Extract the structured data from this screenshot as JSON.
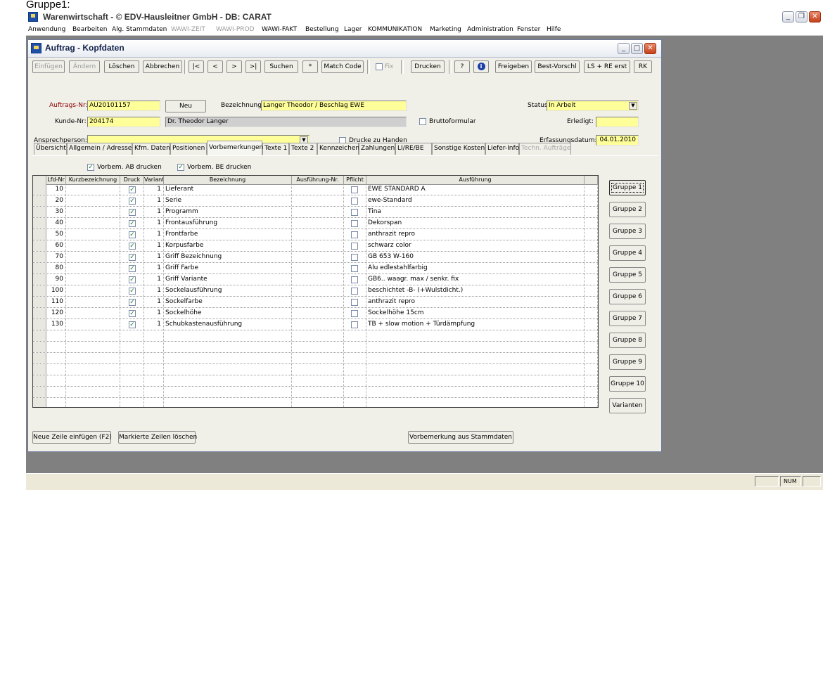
{
  "caption": "Gruppe1:",
  "app": {
    "title": "Warenwirtschaft - © EDV-Hausleitner GmbH - DB: CARAT",
    "menu": [
      "Anwendung",
      "Bearbeiten",
      "Alg. Stammdaten",
      "WAWI-ZEIT",
      "WAWI-PROD",
      "WAWI-FAKT",
      "Bestellung",
      "Lager",
      "KOMMUNIKATION",
      "Marketing",
      "Administration",
      "Fenster",
      "Hilfe"
    ],
    "status_num": "NUM"
  },
  "window": {
    "title": "Auftrag - Kopfdaten",
    "toolbar": {
      "einfuegen": "Einfügen",
      "aendern": "Ändern",
      "loeschen": "Löschen",
      "abbrechen": "Abbrechen",
      "first": "|<",
      "prev": "<",
      "next": ">",
      "last": ">|",
      "suchen": "Suchen",
      "star": "*",
      "match_code": "Match Code",
      "fix": "Fix",
      "drucken": "Drucken",
      "help": "?",
      "info": "i",
      "freigeben": "Freigeben",
      "best_vorschl": "Best-Vorschl",
      "ls_re_erst": "LS + RE erst",
      "rk": "RK"
    },
    "form": {
      "auftrags_nr_label": "Auftrags-Nr:",
      "auftrags_nr": "AU20101157",
      "neu": "Neu",
      "bezeichnung_label": "Bezeichnung:",
      "bezeichnung": "Langer Theodor / Beschlag EWE",
      "status_label": "Status:",
      "status": "In Arbeit",
      "kunde_nr_label": "Kunde-Nr:",
      "kunde_nr": "204174",
      "kunde_name": "Dr. Theodor Langer",
      "bruttoformular": "Bruttoformular",
      "erledigt_label": "Erledigt:",
      "erledigt": "",
      "ansprechperson_label": "Ansprechperson:",
      "ansprechperson": "",
      "drucke_zu_handen": "Drucke zu Handen",
      "erfassungsdatum_label": "Erfassungsdatum:",
      "erfassungsdatum": "04.01.2010"
    },
    "tabs": [
      "Übersicht",
      "Allgemein / Adressen",
      "Kfm. Daten",
      "Positionen",
      "Vorbemerkungen",
      "Texte 1",
      "Texte 2",
      "Kennzeichen",
      "Zahlungen",
      "LI/RE/BE",
      "Sonstige Kosten",
      "Liefer-Info",
      "Techn. Aufträge"
    ],
    "print_ab": "Vorbem. AB drucken",
    "print_be": "Vorbem. BE drucken",
    "grid": {
      "columns": [
        "Lfd-Nr",
        "Kurzbezeichnung",
        "Druck",
        "Variante",
        "Bezeichnung",
        "Ausführung-Nr.",
        "Pflicht",
        "Ausführung"
      ],
      "rows": [
        {
          "nr": "10",
          "kurz": "",
          "var": "1",
          "bez": "Lieferant",
          "ausf_nr": "",
          "ausf": "EWE STANDARD A"
        },
        {
          "nr": "20",
          "kurz": "",
          "var": "1",
          "bez": "Serie",
          "ausf_nr": "",
          "ausf": "ewe-Standard"
        },
        {
          "nr": "30",
          "kurz": "",
          "var": "1",
          "bez": "Programm",
          "ausf_nr": "",
          "ausf": "Tina"
        },
        {
          "nr": "40",
          "kurz": "",
          "var": "1",
          "bez": "Frontausführung",
          "ausf_nr": "",
          "ausf": "Dekorspan"
        },
        {
          "nr": "50",
          "kurz": "",
          "var": "1",
          "bez": "Frontfarbe",
          "ausf_nr": "",
          "ausf": "anthrazit repro"
        },
        {
          "nr": "60",
          "kurz": "",
          "var": "1",
          "bez": "Korpusfarbe",
          "ausf_nr": "",
          "ausf": "schwarz color"
        },
        {
          "nr": "70",
          "kurz": "",
          "var": "1",
          "bez": "Griff Bezeichnung",
          "ausf_nr": "",
          "ausf": "GB 653 W-160"
        },
        {
          "nr": "80",
          "kurz": "",
          "var": "1",
          "bez": "Griff Farbe",
          "ausf_nr": "",
          "ausf": "Alu edlestahlfarbig"
        },
        {
          "nr": "90",
          "kurz": "",
          "var": "1",
          "bez": "Griff Variante",
          "ausf_nr": "",
          "ausf": "GB6.. waagr. max / senkr. fix"
        },
        {
          "nr": "100",
          "kurz": "",
          "var": "1",
          "bez": "Sockelausführung",
          "ausf_nr": "",
          "ausf": "beschichtet -B- (+Wulstdicht.)"
        },
        {
          "nr": "110",
          "kurz": "",
          "var": "1",
          "bez": "Sockelfarbe",
          "ausf_nr": "",
          "ausf": "anthrazit repro"
        },
        {
          "nr": "120",
          "kurz": "",
          "var": "1",
          "bez": "Sockelhöhe",
          "ausf_nr": "",
          "ausf": "Sockelhöhe 15cm"
        },
        {
          "nr": "130",
          "kurz": "",
          "var": "1",
          "bez": "Schubkastenausführung",
          "ausf_nr": "",
          "ausf": "TB + slow motion + Türdämpfung"
        }
      ]
    },
    "groups": [
      "Gruppe 1",
      "Gruppe 2",
      "Gruppe 3",
      "Gruppe 4",
      "Gruppe 5",
      "Gruppe 6",
      "Gruppe 7",
      "Gruppe 8",
      "Gruppe 9",
      "Gruppe 10",
      "Varianten"
    ],
    "bottom": {
      "neue_zeile": "Neue Zeile einfügen (F2)",
      "markierte_loeschen": "Markierte Zeilen löschen",
      "vorbemerkung_stamm": "Vorbemerkung aus Stammdaten"
    }
  }
}
